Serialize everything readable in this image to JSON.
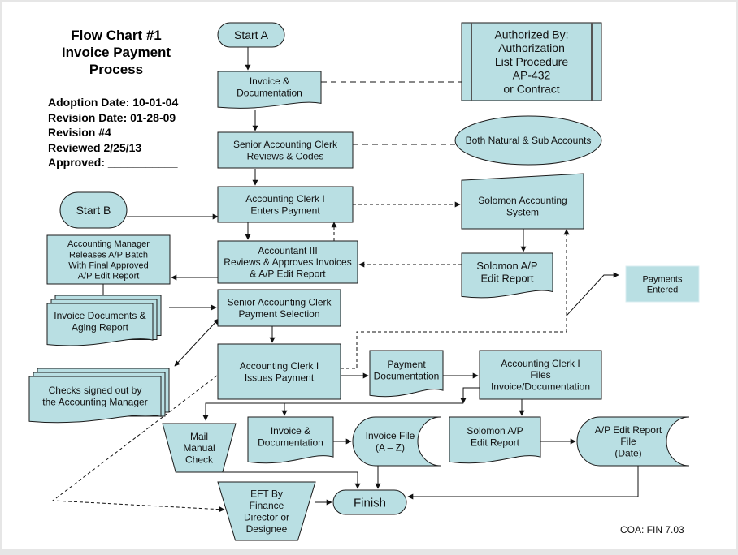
{
  "header": {
    "title_lines": [
      "Flow Chart #1",
      "Invoice Payment",
      "Process"
    ],
    "adoption_date": "Adoption Date: 10-01-04",
    "revision_date": "Revision Date:  01-28-09",
    "revision": "Revision #4",
    "reviewed": "Reviewed 2/25/13",
    "approved": "Approved: ___________"
  },
  "footer": {
    "code": "COA: FIN 7.03"
  },
  "colors": {
    "fill": "#b9dfe3",
    "stroke": "#1a1a1a",
    "background": "#ffffff"
  },
  "nodes": {
    "start_a": {
      "lines": [
        "Start A"
      ]
    },
    "invoice_doc_top": {
      "lines": [
        "Invoice &",
        "Documentation"
      ]
    },
    "authorized_by": {
      "lines": [
        "Authorized By:",
        "Authorization",
        "List Procedure",
        "AP-432",
        "or Contract"
      ]
    },
    "senior_clerk_reviews": {
      "lines": [
        "Senior Accounting Clerk",
        "Reviews & Codes"
      ]
    },
    "both_accounts": {
      "lines": [
        "Both Natural & Sub Accounts"
      ]
    },
    "start_b": {
      "lines": [
        "Start B"
      ]
    },
    "clerk_enters": {
      "lines": [
        "Accounting Clerk I",
        "Enters Payment"
      ]
    },
    "solomon_system": {
      "lines": [
        "Solomon Accounting",
        "System"
      ]
    },
    "acct_mgr_releases": {
      "lines": [
        "Accounting Manager",
        "Releases A/P Batch",
        "With Final Approved",
        "A/P Edit Report"
      ]
    },
    "accountant_iii": {
      "lines": [
        "Accountant III",
        "Reviews & Approves Invoices",
        "& A/P Edit Report"
      ]
    },
    "solomon_ap_report": {
      "lines": [
        "Solomon A/P",
        "Edit Report"
      ]
    },
    "payments_entered": {
      "lines": [
        "Payments",
        "Entered"
      ]
    },
    "invoice_docs_aging": {
      "lines": [
        "Invoice Documents &",
        "Aging Report"
      ]
    },
    "senior_clerk_selection": {
      "lines": [
        "Senior Accounting Clerk",
        "Payment Selection"
      ]
    },
    "checks_signed": {
      "lines": [
        "Checks signed out by",
        "the Accounting Manager"
      ]
    },
    "clerk_issues": {
      "lines": [
        "Accounting Clerk I",
        "Issues Payment"
      ]
    },
    "payment_doc": {
      "lines": [
        "Payment",
        "Documentation"
      ]
    },
    "clerk_files": {
      "lines": [
        "Accounting Clerk I",
        "Files",
        "Invoice/Documentation"
      ]
    },
    "mail_check": {
      "lines": [
        "Mail",
        "Manual",
        "Check"
      ]
    },
    "invoice_doc_bottom": {
      "lines": [
        "Invoice &",
        "Documentation"
      ]
    },
    "invoice_file": {
      "lines": [
        "Invoice File",
        "(A – Z)"
      ]
    },
    "solomon_ap_report_2": {
      "lines": [
        "Solomon A/P",
        "Edit Report"
      ]
    },
    "ap_report_file": {
      "lines": [
        "A/P Edit Report",
        "File",
        "(Date)"
      ]
    },
    "eft": {
      "lines": [
        "EFT By",
        "Finance",
        "Director or",
        "Designee"
      ]
    },
    "finish": {
      "lines": [
        "Finish"
      ]
    }
  }
}
